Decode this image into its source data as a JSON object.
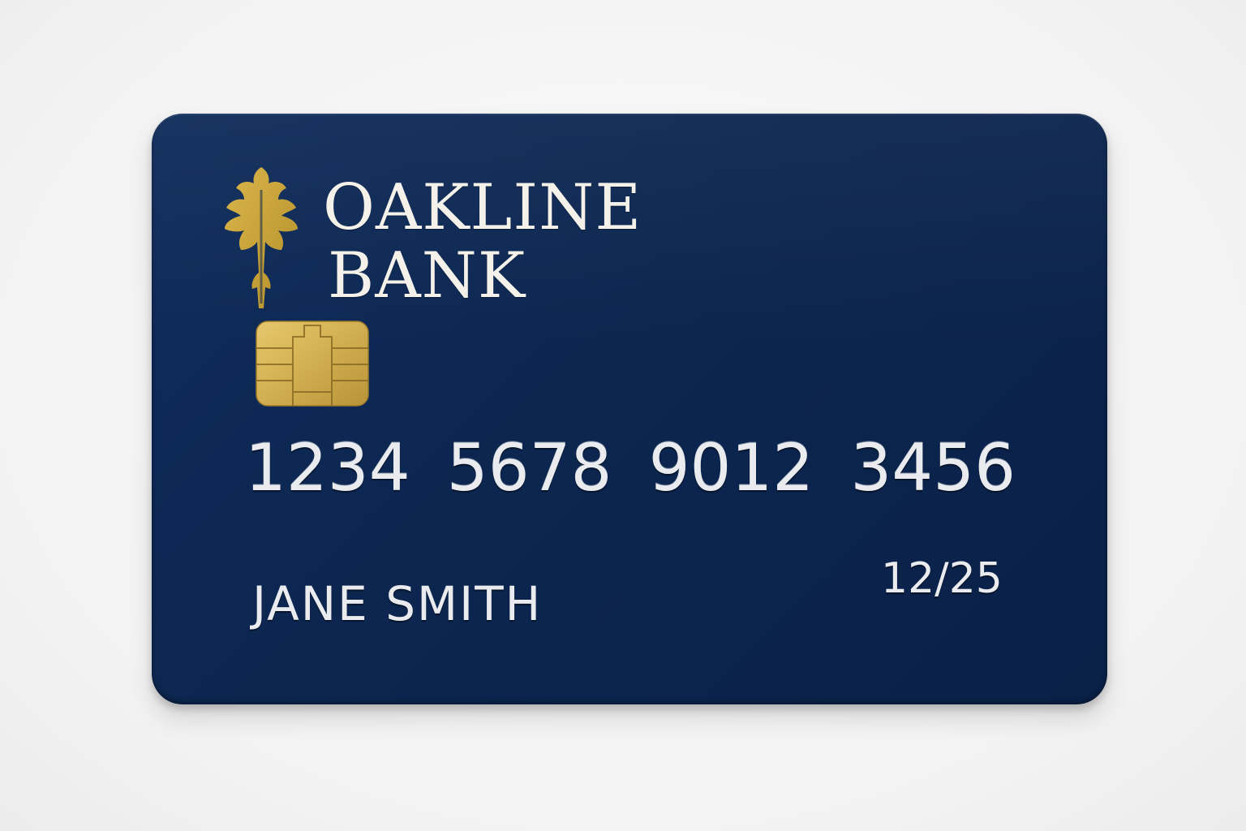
{
  "card": {
    "bank_name_line1": "OAKLINE",
    "bank_name_line2": "BANK",
    "number_groups": [
      "1234",
      "5678",
      "9012",
      "3456"
    ],
    "expiry": "12/25",
    "cardholder": "JANE SMITH",
    "logo_icon": "oak-leaf-icon",
    "chip_icon": "emv-chip-icon",
    "colors": {
      "card_background": "#0c2650",
      "logo_gold": "#c9a43a",
      "chip_gold": "#d6b458",
      "text": "#e9ebee"
    }
  }
}
